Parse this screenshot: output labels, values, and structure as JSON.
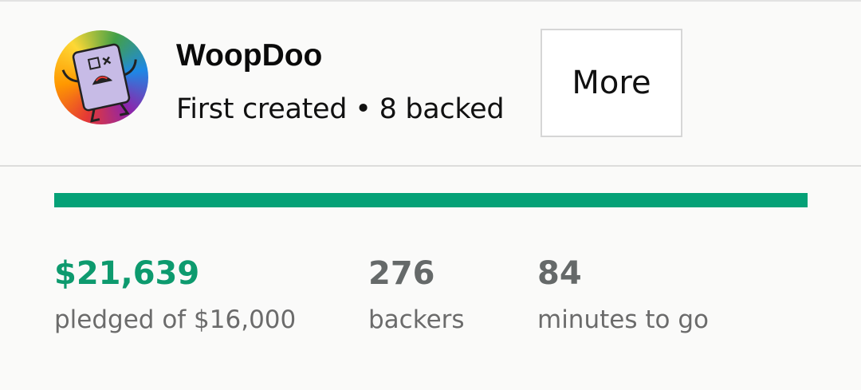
{
  "creator": {
    "name": "WoopDoo",
    "first_created": "First created",
    "separator": "•",
    "backed": "8 backed",
    "more_label": "More"
  },
  "progress": {
    "funded_fraction": 1.0,
    "fill_color": "#05a177"
  },
  "stats": {
    "pledged_value": "$21,639",
    "pledged_label": "pledged of $16,000",
    "backers_value": "276",
    "backers_label": "backers",
    "time_value": "84",
    "time_label": "minutes to go"
  },
  "colors": {
    "accent_green": "#0d9a6e",
    "muted_text": "#656969"
  },
  "icons": {
    "avatar": "creator-avatar-image"
  }
}
